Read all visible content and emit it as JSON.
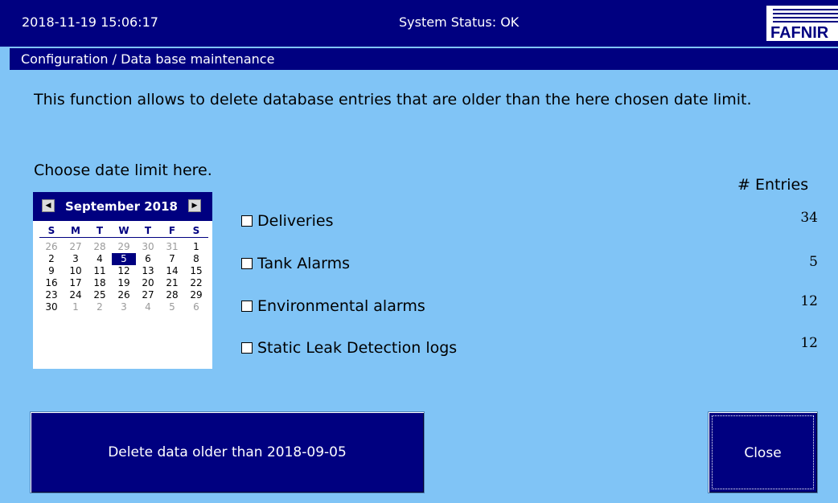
{
  "header": {
    "datetime": "2018-11-19  15:06:17",
    "status": "System Status: OK",
    "logo_text": "FAFNIR"
  },
  "subheader": {
    "title": "Configuration / Data base maintenance"
  },
  "description": "This function allows to delete database entries that are older than the here chosen date limit.",
  "choose_label": "Choose date limit here.",
  "entries_header": "# Entries",
  "calendar": {
    "prev_glyph": "◀",
    "next_glyph": "▶",
    "month_label": "September 2018",
    "days_of_week": [
      "S",
      "M",
      "T",
      "W",
      "T",
      "F",
      "S"
    ],
    "weeks": [
      [
        "26",
        "27",
        "28",
        "29",
        "30",
        "31",
        "1"
      ],
      [
        "2",
        "3",
        "4",
        "5",
        "6",
        "7",
        "8"
      ],
      [
        "9",
        "10",
        "11",
        "12",
        "13",
        "14",
        "15"
      ],
      [
        "16",
        "17",
        "18",
        "19",
        "20",
        "21",
        "22"
      ],
      [
        "23",
        "24",
        "25",
        "26",
        "27",
        "28",
        "29"
      ],
      [
        "30",
        "1",
        "2",
        "3",
        "4",
        "5",
        "6"
      ]
    ],
    "selected": "5"
  },
  "options": [
    {
      "label": "Deliveries",
      "count": "34",
      "checked": false
    },
    {
      "label": "Tank Alarms",
      "count": "5",
      "checked": false
    },
    {
      "label": "Environmental alarms",
      "count": "12",
      "checked": false
    },
    {
      "label": "Static Leak Detection logs",
      "count": "12",
      "checked": false
    }
  ],
  "buttons": {
    "delete_label": "Delete data older than 2018-09-05",
    "close_label": "Close"
  },
  "colors": {
    "background": "#80c4f6",
    "bar": "#000080",
    "selected": "#000080"
  }
}
